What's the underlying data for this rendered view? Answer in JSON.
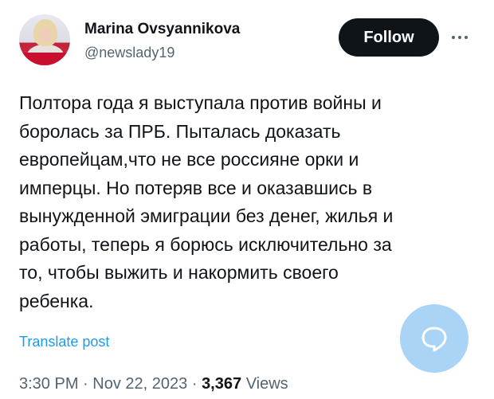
{
  "author": {
    "name": "Marina Ovsyannikova",
    "handle": "@newslady19"
  },
  "actions": {
    "follow_label": "Follow",
    "more_icon": "more-horizontal-icon",
    "fab_icon": "reply-bubble-icon"
  },
  "tweet": {
    "lines": [
      "Полтора года я выступала против войны и",
      "боролась за ПРБ. Пыталась доказать",
      "европейцам,что не все россияне орки и",
      "имперцы. Но потеряв все и оказавшись в",
      "вынужденной эмиграции без денег, жилья и",
      "работы, теперь я борюсь исключительно за",
      "то, чтобы выжить и накормить своего",
      "ребенка."
    ],
    "translate_label": "Translate post"
  },
  "meta": {
    "time": "3:30 PM",
    "date": "Nov 22, 2023",
    "separator": "·",
    "views_count": "3,367",
    "views_label": "Views"
  },
  "colors": {
    "text": "#0f1419",
    "secondary": "#536471",
    "link": "#1d9bf0",
    "button_bg": "#0f1419",
    "fab_bg": "#a9d4f5"
  }
}
